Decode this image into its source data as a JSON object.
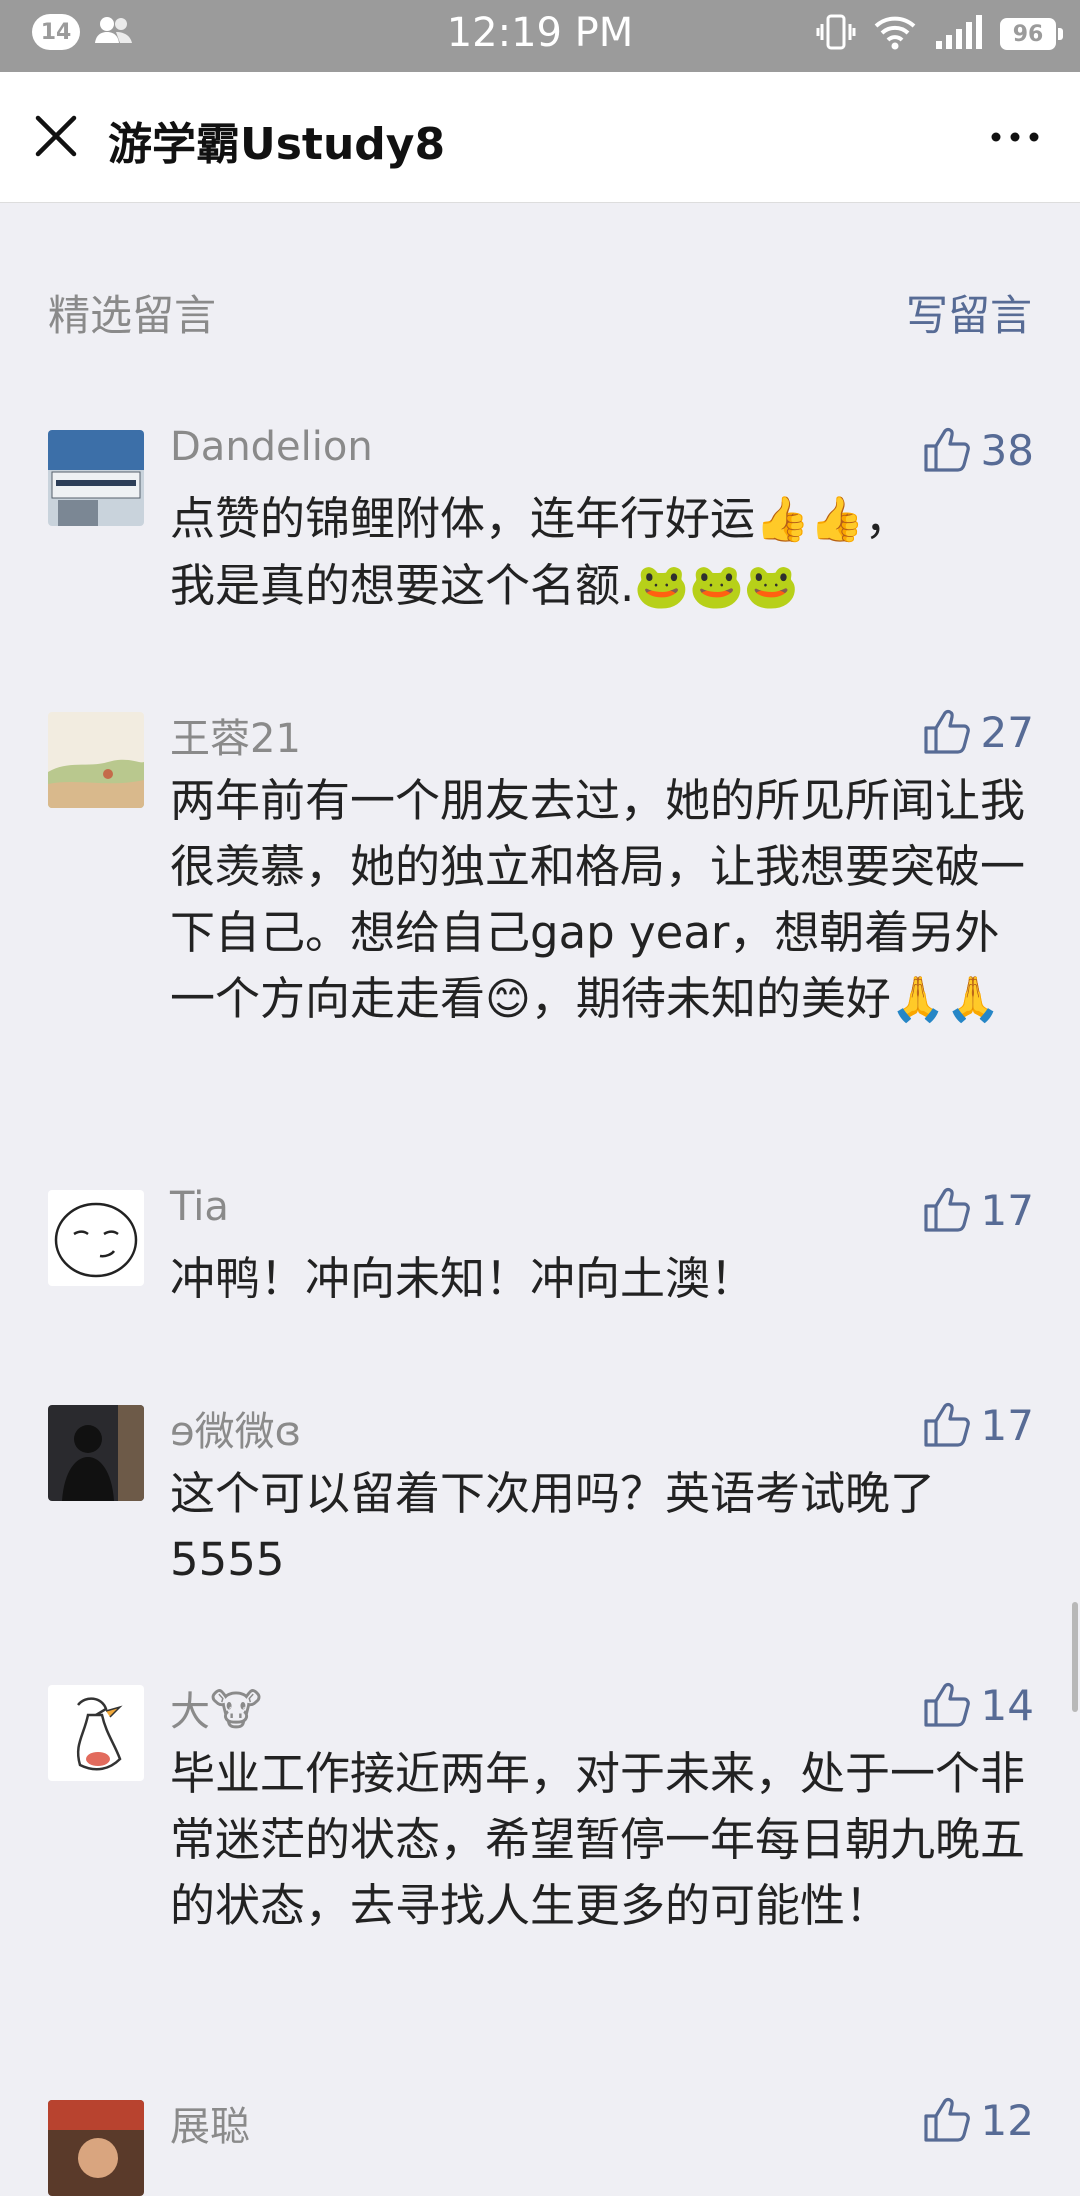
{
  "status_bar": {
    "notification_count": "14",
    "time": "12:19 PM",
    "battery": "96"
  },
  "nav": {
    "title": "游学霸Ustudy8"
  },
  "section": {
    "title": "精选留言",
    "write_label": "写留言"
  },
  "comments": [
    {
      "nickname": "Dandelion",
      "likes": "38",
      "text_1": "点赞的锦鲤附体，连年行好运",
      "emoji_1": "👍👍",
      "text_2": "，",
      "text_3": "我是真的想要这个名额.",
      "emoji_2": "🐸🐸🐸"
    },
    {
      "nickname": "王蓉21",
      "likes": "27",
      "text_1": "两年前有一个朋友去过，她的所见所闻让我很羡慕，她的独立和格局，让我想要突破一下自己。想给自己gap year，想朝着另外一个方向走走看",
      "emoji_1": "😊",
      "text_2": "，期待未知的美好",
      "emoji_2": "🙏🙏"
    },
    {
      "nickname": "Tia",
      "likes": "17",
      "text": "冲鸭！冲向未知！冲向土澳！"
    },
    {
      "nickname": "ɘ微微ɞ",
      "likes": "17",
      "text": "这个可以留着下次用吗？英语考试晚了5555"
    },
    {
      "nickname": "大",
      "nickname_emoji": "🐮",
      "likes": "14",
      "text": "毕业工作接近两年，对于未来，处于一个非常迷茫的状态，希望暂停一年每日朝九晚五的状态，去寻找人生更多的可能性！"
    },
    {
      "nickname": "展聪",
      "likes": "12"
    }
  ],
  "colors": {
    "accent": "#576b95",
    "background": "#efeff4",
    "status_bar": "#9b9b9b"
  }
}
